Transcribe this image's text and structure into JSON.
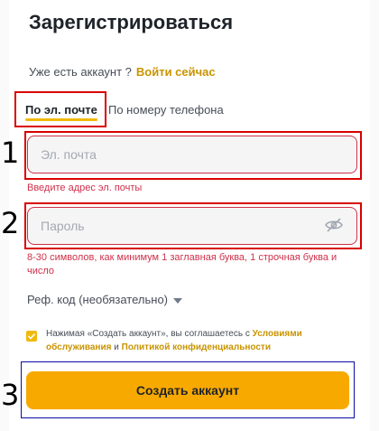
{
  "page": {
    "title": "Зарегистрироваться"
  },
  "login_prompt": {
    "text": "Уже есть аккаунт ?",
    "link": "Войти сейчас"
  },
  "tabs": [
    {
      "label": "По эл. почте",
      "active": true
    },
    {
      "label": "По номеру телефона",
      "active": false
    }
  ],
  "annotations": [
    "1",
    "2",
    "3"
  ],
  "email": {
    "placeholder": "Эл. почта",
    "value": "",
    "error": "Введите адрес эл. почты"
  },
  "password": {
    "placeholder": "Пароль",
    "value": "",
    "error_line1": "8-30 символов, как минимум 1 заглавная буква, 1 строчная буква и",
    "error_line2": "число",
    "toggle_icon": "eye-slash-icon"
  },
  "referral": {
    "label": "Реф. код (необязательно)"
  },
  "terms": {
    "checked": true,
    "prefix": "Нажимая «Создать аккаунт», вы соглашаетесь с",
    "link1": "Условиями обслуживания",
    "middle": "и",
    "link2": "Политикой конфиденциальности"
  },
  "submit": {
    "label": "Создать аккаунт"
  },
  "colors": {
    "accent": "#f0b90b",
    "link": "#c99400",
    "error": "#cf304a",
    "button": "#f8a900",
    "annotation_red": "#d90000",
    "annotation_blue": "#0a0aa6"
  }
}
